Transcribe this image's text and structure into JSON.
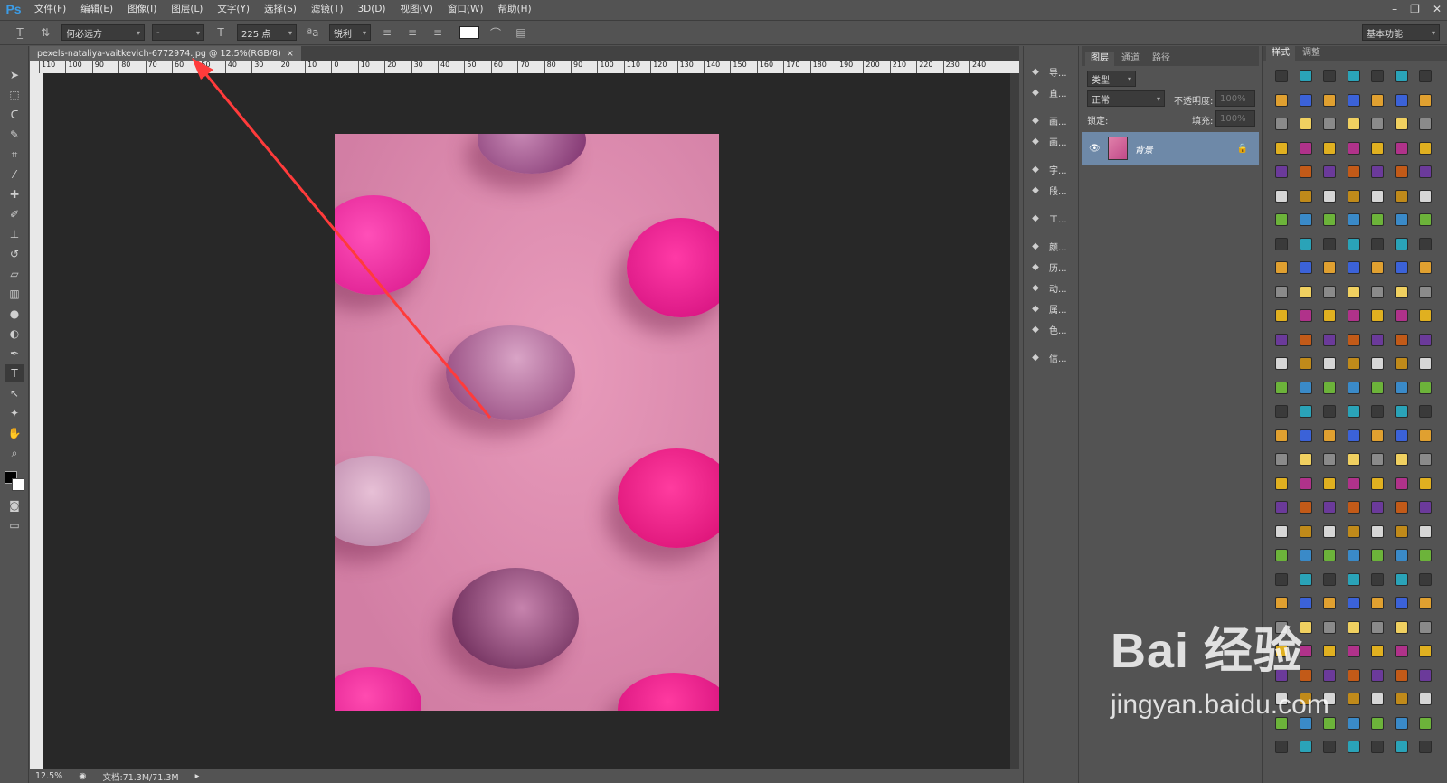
{
  "app": {
    "logo": "Ps"
  },
  "menu": [
    "文件(F)",
    "编辑(E)",
    "图像(I)",
    "图层(L)",
    "文字(Y)",
    "选择(S)",
    "滤镜(T)",
    "3D(D)",
    "视图(V)",
    "窗口(W)",
    "帮助(H)"
  ],
  "window_controls": [
    "–",
    "❐",
    "✕"
  ],
  "options": {
    "font_family": "何必远方",
    "font_style": "-",
    "font_size": "225 点",
    "antialias": "锐利",
    "workspace": "基本功能"
  },
  "document": {
    "tab_title": "pexels-nataliya-vaitkevich-6772974.jpg @ 12.5%(RGB/8)",
    "tab_close": "×",
    "zoom": "12.5%",
    "doc_size": "文档:71.3M/71.3M"
  },
  "rulers": {
    "h_ticks": [
      "110",
      "100",
      "90",
      "80",
      "70",
      "60",
      "50",
      "40",
      "30",
      "20",
      "10",
      "0",
      "10",
      "20",
      "30",
      "40",
      "50",
      "60",
      "70",
      "80",
      "90",
      "100",
      "110",
      "120",
      "130",
      "140",
      "150",
      "160",
      "170",
      "180",
      "190",
      "200",
      "210",
      "220",
      "230",
      "240"
    ]
  },
  "icon_panel": [
    {
      "icon": "navigator-icon",
      "label": "导..."
    },
    {
      "icon": "histogram-icon",
      "label": "直..."
    },
    {
      "icon": "brush-preset-icon",
      "label": "画..."
    },
    {
      "icon": "brush-icon",
      "label": "画..."
    },
    {
      "icon": "character-icon",
      "label": "字..."
    },
    {
      "icon": "paragraph-icon",
      "label": "段..."
    },
    {
      "icon": "tool-preset-icon",
      "label": "工..."
    },
    {
      "icon": "3d-icon",
      "label": "颜..."
    },
    {
      "icon": "history-icon",
      "label": "历..."
    },
    {
      "icon": "actions-icon",
      "label": "动..."
    },
    {
      "icon": "properties-icon",
      "label": "属..."
    },
    {
      "icon": "swatch-icon",
      "label": "色..."
    },
    {
      "icon": "info-icon",
      "label": "信..."
    }
  ],
  "layers_panel": {
    "tabs": [
      "图层",
      "通道",
      "路径"
    ],
    "filter": "类型",
    "blend_mode": "正常",
    "opacity_label": "不透明度:",
    "opacity_value": "100%",
    "lock_label": "锁定:",
    "fill_label": "填充:",
    "fill_value": "100%",
    "layer_name": "背景"
  },
  "styles_panel": {
    "tabs": [
      "样式",
      "调整"
    ]
  },
  "watermark": {
    "text_main": "Bai  经验",
    "text_url": "jingyan.baidu.com"
  },
  "colors": {
    "accent": "#3c9ce6",
    "arrow": "#ff3b3b",
    "photo_bg": "#e494b6"
  }
}
